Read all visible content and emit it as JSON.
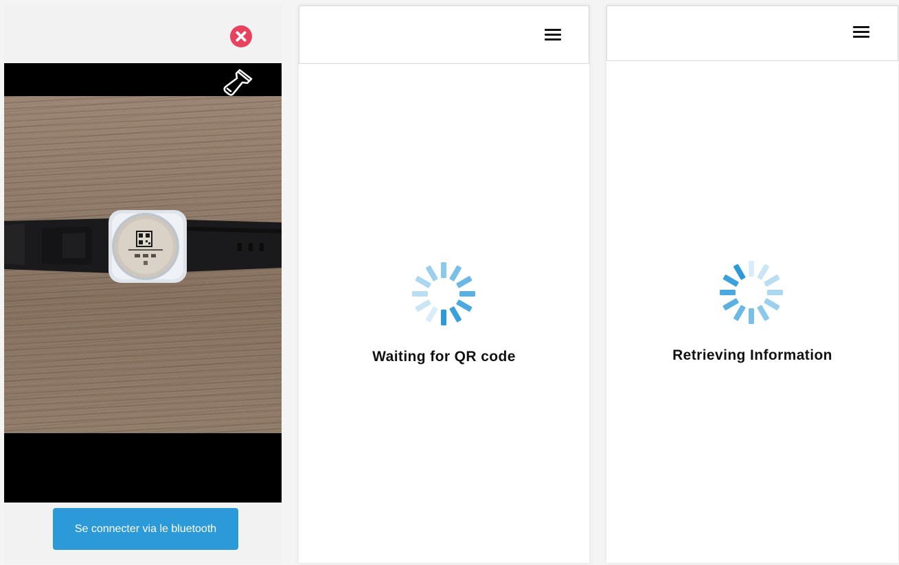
{
  "scanner": {
    "close_icon": "close-circle-icon",
    "flashlight_icon": "flashlight-icon",
    "bluetooth_button_label": "Se connecter via le bluetooth",
    "colors": {
      "close": "#e8425f",
      "button": "#2c9ad9"
    }
  },
  "waiting": {
    "menu_icon": "hamburger-menu-icon",
    "status_text": "Waiting for QR code"
  },
  "retrieving": {
    "menu_icon": "hamburger-menu-icon",
    "status_text": "Retrieving Information"
  },
  "spinner_color": "#2c9ad9"
}
